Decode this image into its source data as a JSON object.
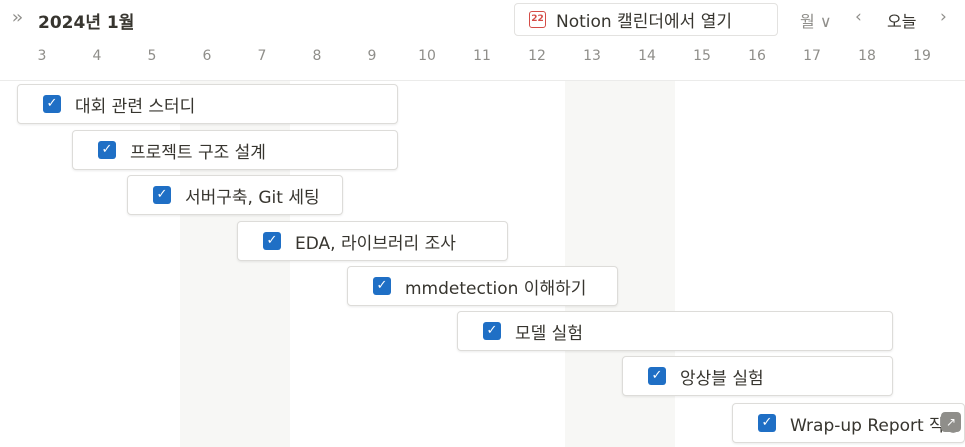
{
  "header": {
    "month_title": "2024년 1월",
    "open_in_calendar": "Notion 캘린더에서 열기",
    "calendar_icon_number": "22",
    "view_mode": "월",
    "today_label": "오늘"
  },
  "days": [
    "3",
    "4",
    "5",
    "6",
    "7",
    "8",
    "9",
    "10",
    "11",
    "12",
    "13",
    "14",
    "15",
    "16",
    "17",
    "18",
    "19"
  ],
  "tasks": [
    {
      "title": "대회 관련 스터디",
      "checked": true
    },
    {
      "title": "프로젝트 구조 설계",
      "checked": true
    },
    {
      "title": "서버구축, Git 세팅",
      "checked": true
    },
    {
      "title": "EDA, 라이브러리 조사",
      "checked": true
    },
    {
      "title": "mmdetection 이해하기",
      "checked": true
    },
    {
      "title": "모델 실험",
      "checked": true
    },
    {
      "title": "앙상블 실험",
      "checked": true
    },
    {
      "title": "Wrap-up Report 작성",
      "checked": true
    }
  ],
  "icons": {
    "expand": "double-chevron-right-icon",
    "calendar": "calendar-22-icon",
    "view_dropdown": "chevron-down-icon",
    "prev": "chevron-left-icon",
    "next": "chevron-right-icon",
    "checkbox": "checkmark-icon"
  },
  "colors": {
    "checkbox": "#1f6fc5",
    "calendar_icon": "#d44c47",
    "weekend_shade": "#f7f7f5",
    "muted_text": "#8f8e8a"
  }
}
